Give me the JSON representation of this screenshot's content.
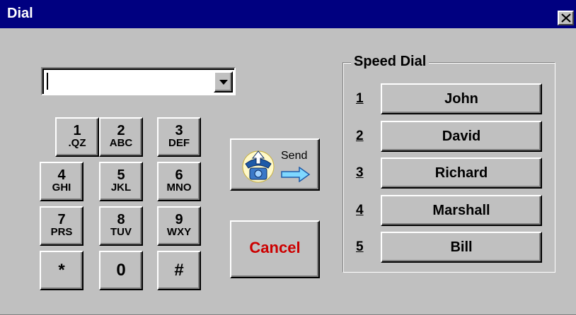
{
  "window": {
    "title": "Dial"
  },
  "number_combo": {
    "value": "",
    "placeholder": ""
  },
  "keypad": {
    "keys": [
      {
        "digit": "1",
        "letters": ".QZ"
      },
      {
        "digit": "2",
        "letters": "ABC"
      },
      {
        "digit": "3",
        "letters": "DEF"
      },
      {
        "digit": "4",
        "letters": "GHI"
      },
      {
        "digit": "5",
        "letters": "JKL"
      },
      {
        "digit": "6",
        "letters": "MNO"
      },
      {
        "digit": "7",
        "letters": "PRS"
      },
      {
        "digit": "8",
        "letters": "TUV"
      },
      {
        "digit": "9",
        "letters": "WXY"
      },
      {
        "digit": "*",
        "letters": ""
      },
      {
        "digit": "0",
        "letters": ""
      },
      {
        "digit": "#",
        "letters": ""
      }
    ]
  },
  "send": {
    "label": "Send",
    "icon": "telephone-send-icon"
  },
  "cancel": {
    "label": "Cancel",
    "color": "#cc0000"
  },
  "speed_dial": {
    "title": "Speed Dial",
    "entries": [
      {
        "number": "1",
        "name": "John"
      },
      {
        "number": "2",
        "name": "David"
      },
      {
        "number": "3",
        "name": "Richard"
      },
      {
        "number": "4",
        "name": "Marshall"
      },
      {
        "number": "5",
        "name": "Bill"
      }
    ]
  },
  "colors": {
    "titlebar": "#000080",
    "face": "#c0c0c0",
    "cancel_text": "#cc0000"
  }
}
